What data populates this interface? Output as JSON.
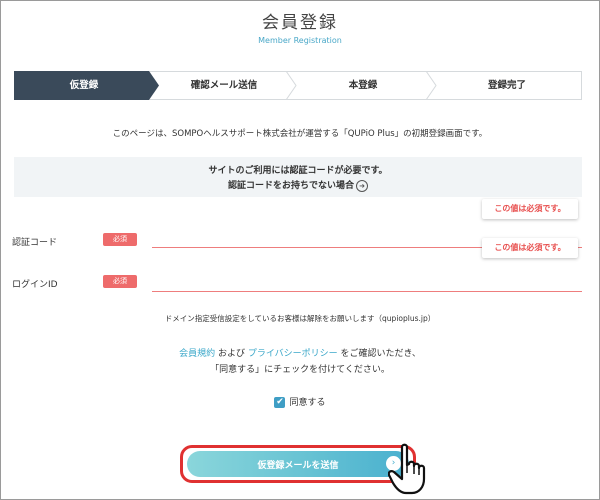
{
  "header": {
    "title": "会員登録",
    "subtitle": "Member Registration"
  },
  "steps": [
    {
      "label": "仮登録",
      "active": true
    },
    {
      "label": "確認メール送信",
      "active": false
    },
    {
      "label": "本登録",
      "active": false
    },
    {
      "label": "登録完了",
      "active": false
    }
  ],
  "intro_text": "このページは、SOMPOヘルスサポート株式会社が運営する「QUPiO Plus」の初期登録画面です。",
  "notice": {
    "line1": "サイトのご利用には認証コードが必要です。",
    "line2": "認証コードをお持ちでない場合"
  },
  "form": {
    "auth_code": {
      "label": "認証コード",
      "required_badge": "必須",
      "value": "",
      "error": "この値は必須です。"
    },
    "login_id": {
      "label": "ログインID",
      "required_badge": "必須",
      "value": "",
      "error": "この値は必須です。"
    }
  },
  "domain_note": "ドメイン指定受信設定をしているお客様は解除をお願いします（qupioplus.jp）",
  "consent": {
    "terms_link": "会員規約",
    "and_text": "および",
    "privacy_link": "プライバシーポリシー",
    "confirm_text": "をご確認いただき、",
    "line2": "「同意する」にチェックを付けてください。"
  },
  "agree": {
    "label": "同意する",
    "checked": true
  },
  "submit": {
    "label": "仮登録メールを送信"
  },
  "colors": {
    "step_active": "#3a4a5a",
    "step_inactive": "#ffffff",
    "link": "#3aa7c9",
    "error": "#e8504f",
    "required_badge": "#ee6b6b",
    "highlight_border": "#e03131",
    "checkbox": "#3f9ec5"
  }
}
